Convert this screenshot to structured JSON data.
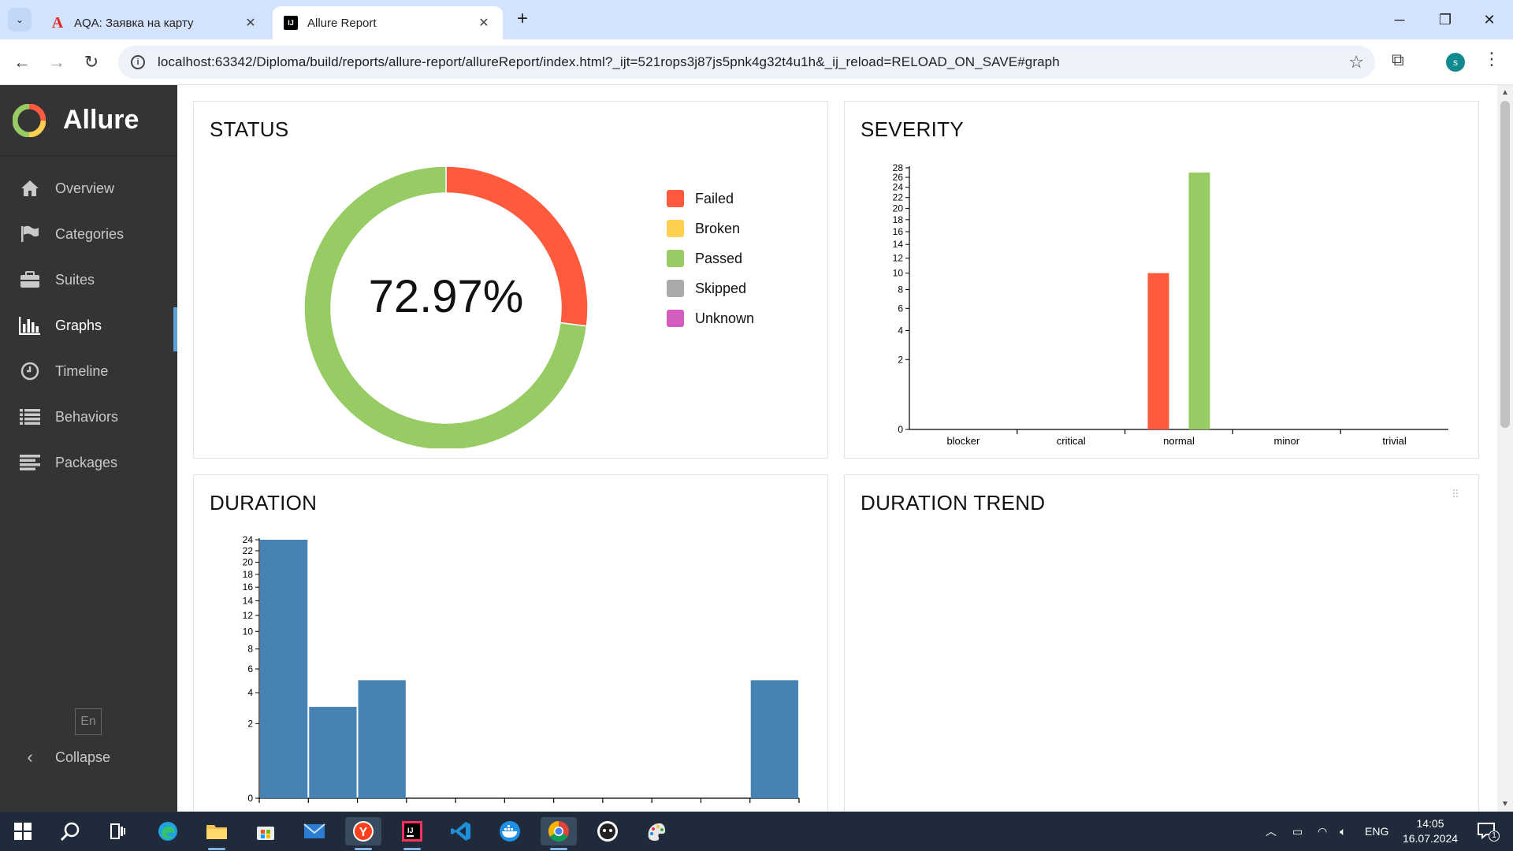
{
  "browser": {
    "tabs": [
      {
        "title": "AQA: Заявка на карту",
        "active": false
      },
      {
        "title": "Allure Report",
        "active": true
      }
    ],
    "new_tab": "+",
    "url": "localhost:63342/Diploma/build/reports/allure-report/allureReport/index.html?_ijt=521rops3j87js5pnk4g32t4u1h&_ij_reload=RELOAD_ON_SAVE#graph",
    "profile_initial": "s"
  },
  "sidebar": {
    "brand": "Allure",
    "items": [
      {
        "label": "Overview",
        "icon": "home-icon"
      },
      {
        "label": "Categories",
        "icon": "flag-icon"
      },
      {
        "label": "Suites",
        "icon": "briefcase-icon"
      },
      {
        "label": "Graphs",
        "icon": "bar-chart-icon",
        "active": true
      },
      {
        "label": "Timeline",
        "icon": "clock-icon"
      },
      {
        "label": "Behaviors",
        "icon": "list-icon"
      },
      {
        "label": "Packages",
        "icon": "align-left-icon"
      }
    ],
    "language": "En",
    "collapse": "Collapse"
  },
  "widgets": {
    "status_title": "STATUS",
    "severity_title": "SEVERITY",
    "duration_title": "DURATION",
    "trend_title": "DURATION TREND"
  },
  "chart_data": [
    {
      "type": "pie",
      "title": "STATUS",
      "center_label": "72.97%",
      "legend": [
        {
          "name": "Failed",
          "color": "#fd5a3e"
        },
        {
          "name": "Broken",
          "color": "#ffd050"
        },
        {
          "name": "Passed",
          "color": "#97cc64"
        },
        {
          "name": "Skipped",
          "color": "#aaaaaa"
        },
        {
          "name": "Unknown",
          "color": "#d35ebe"
        }
      ],
      "slices": [
        {
          "name": "Failed",
          "value": 10,
          "color": "#fd5a3e"
        },
        {
          "name": "Passed",
          "value": 27,
          "color": "#97cc64"
        }
      ]
    },
    {
      "type": "bar",
      "title": "SEVERITY",
      "categories": [
        "blocker",
        "critical",
        "normal",
        "minor",
        "trivial"
      ],
      "series": [
        {
          "name": "Failed",
          "color": "#fd5a3e",
          "values": [
            0,
            0,
            10,
            0,
            0
          ]
        },
        {
          "name": "Passed",
          "color": "#97cc64",
          "values": [
            0,
            0,
            27,
            0,
            0
          ]
        }
      ],
      "y_ticks": [
        0,
        2,
        4,
        6,
        8,
        10,
        12,
        14,
        16,
        18,
        20,
        22,
        24,
        26,
        28
      ],
      "ylim": [
        0,
        28
      ],
      "y_scale": "sqrt"
    },
    {
      "type": "bar",
      "title": "DURATION",
      "color": "#4682b4",
      "bins": 11,
      "values": [
        24,
        3,
        5,
        0,
        0,
        0,
        0,
        0,
        0,
        0,
        5
      ],
      "y_ticks": [
        0,
        2,
        4,
        6,
        8,
        10,
        12,
        14,
        16,
        18,
        20,
        22,
        24
      ],
      "ylim": [
        0,
        24
      ],
      "y_scale": "sqrt"
    }
  ],
  "taskbar": {
    "apps": [
      "windows-start-icon",
      "search-icon",
      "task-view-icon",
      "edge-icon",
      "file-explorer-icon",
      "store-icon",
      "mail-icon",
      "yandex-browser-icon",
      "intellij-icon",
      "vscode-icon",
      "docker-icon",
      "chrome-icon",
      "github-desktop-icon",
      "paint-icon"
    ],
    "language": "ENG",
    "time": "14:05",
    "date": "16.07.2024",
    "notification_count": "1"
  }
}
